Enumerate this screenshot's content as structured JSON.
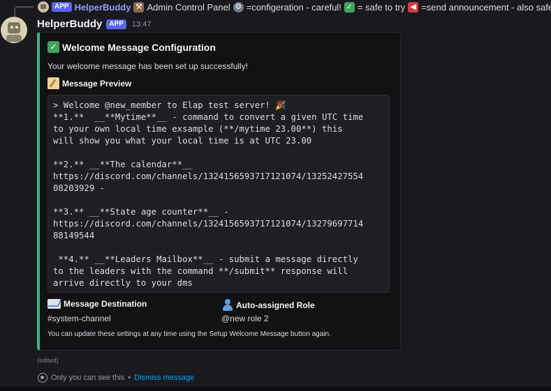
{
  "reply": {
    "app_tag": "APP",
    "bot_name": "HelperBuddy",
    "text_part1": "Admin Control Panel",
    "text_part2": "=configeration - careful!",
    "text_part3": "= safe to try",
    "text_part4": "=send announcement - also safe",
    "icons": [
      "hammer-wrench-icon",
      "gear-icon",
      "check-icon",
      "megaphone-icon",
      "pencil-icon"
    ]
  },
  "message": {
    "bot_name": "HelperBuddy",
    "app_tag": "APP",
    "timestamp": "13:47",
    "edited_label": "(edited)"
  },
  "embed": {
    "accent_color": "#43b581",
    "title": "Welcome Message Configuration",
    "description": "Your welcome message has been set up successfully!",
    "preview_title": "Message Preview",
    "preview_text": "> Welcome @new_member to Elap test server! 🎉\n**1.**  __**Mytime**__ - command to convert a given UTC time\nto your own local time exsample (**/mytime 23.00**) this\nwill show you what your local time is at UTC 23.00\n\n**2.** __**The calendar**__\nhttps://discord.com/channels/1324156593717121074/13252427554\n08203929 -\n\n**3.** __**State age counter**__ -\nhttps://discord.com/channels/1324156593717121074/13279697714\n88149544\n\n **4.** __**Leaders Mailbox**__ - submit a message directly\nto the leaders with the command **/submit** response will\narrive directly to your dms",
    "destination_title": "Message Destination",
    "destination_value": "#system-channel",
    "role_title": "Auto-assigned Role",
    "role_value": "@new role 2",
    "footer_note": "You can update these settings at any time using the Setup Welcome Message button again."
  },
  "ephemeral": {
    "text": "Only you can see this",
    "separator": "•",
    "dismiss_label": "Dismiss message"
  }
}
